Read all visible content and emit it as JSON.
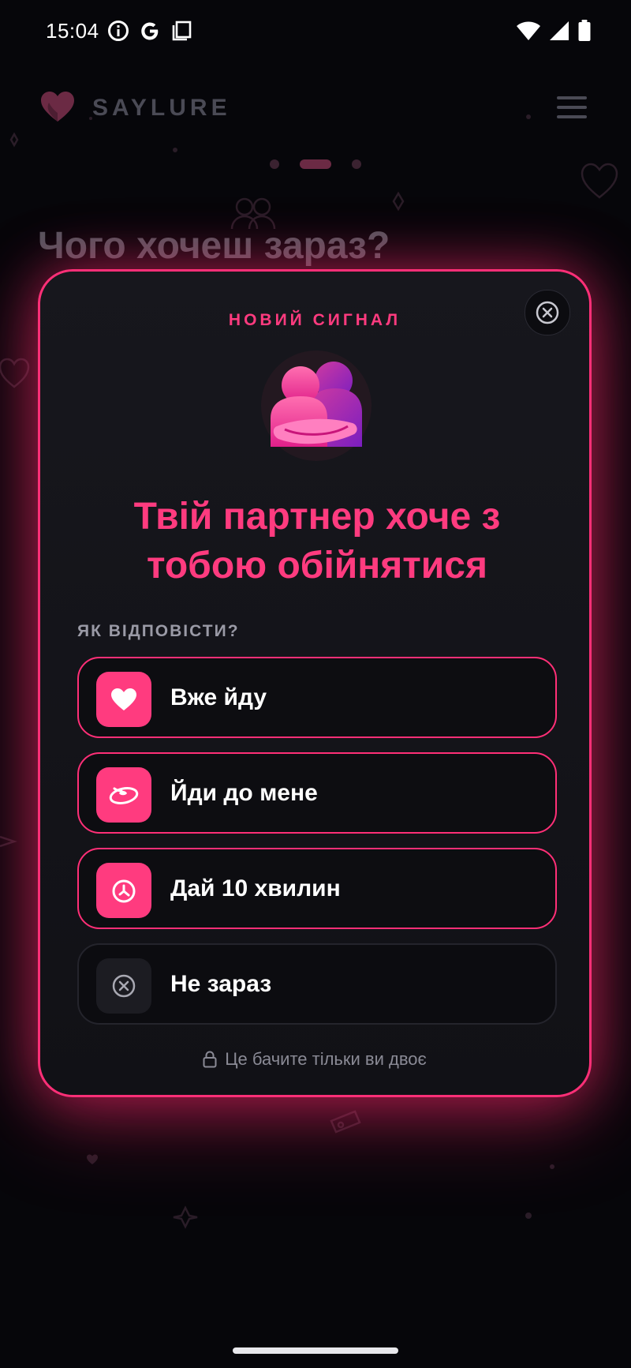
{
  "status_bar": {
    "time": "15:04",
    "left_icons": [
      "info-icon",
      "google-icon",
      "screenshot-icon"
    ],
    "right_icons": [
      "wifi-icon",
      "signal-icon",
      "battery-icon"
    ]
  },
  "background_app": {
    "brand_name": "SAYLURE",
    "heading": "Чого хочеш зараз?"
  },
  "modal": {
    "eyebrow": "НОВИЙ СИГНАЛ",
    "title": "Твій партнер хоче з тобою обійнятися",
    "question": "ЯК ВІДПОВІСТИ?",
    "options": [
      {
        "label": "Вже йду",
        "icon": "heart-icon"
      },
      {
        "label": "Йди до мене",
        "icon": "hug-ring-icon"
      },
      {
        "label": "Дай 10 хвилин",
        "icon": "timer-icon"
      },
      {
        "label": "Не зараз",
        "icon": "close-circle-icon"
      }
    ],
    "privacy_note": "Це бачите тільки ви двоє"
  },
  "colors": {
    "accent": "#ff3b7f",
    "background": "#06060a",
    "modal_bg": "#15151b"
  }
}
